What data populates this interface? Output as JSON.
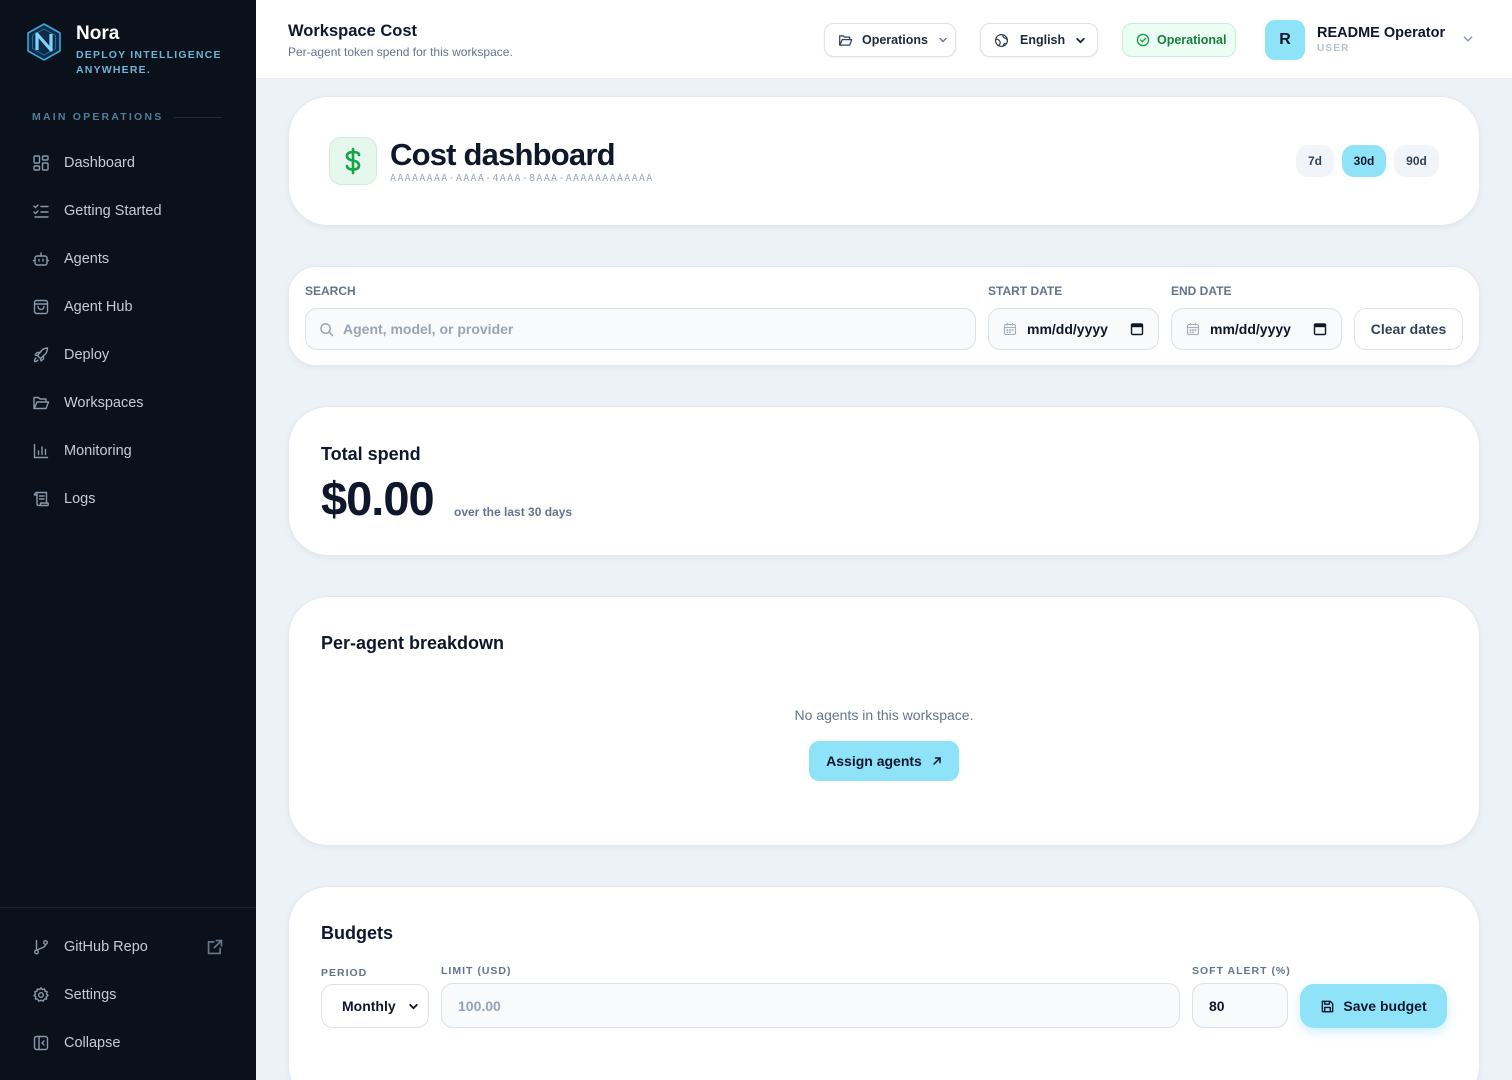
{
  "brand": {
    "name": "Nora",
    "tagline": "DEPLOY INTELLIGENCE ANYWHERE.",
    "logo_letter": "N"
  },
  "sidebar": {
    "section_label": "MAIN OPERATIONS",
    "items": [
      {
        "label": "Dashboard",
        "icon": "dashboard-icon"
      },
      {
        "label": "Getting Started",
        "icon": "checklist-icon"
      },
      {
        "label": "Agents",
        "icon": "bot-icon"
      },
      {
        "label": "Agent Hub",
        "icon": "shopping-bag-icon"
      },
      {
        "label": "Deploy",
        "icon": "rocket-icon"
      },
      {
        "label": "Workspaces",
        "icon": "folder-icon"
      },
      {
        "label": "Monitoring",
        "icon": "bar-chart-icon"
      },
      {
        "label": "Logs",
        "icon": "scroll-icon"
      }
    ],
    "bottom": [
      {
        "label": "GitHub Repo",
        "icon": "git-branch-icon",
        "external": true
      },
      {
        "label": "Settings",
        "icon": "gear-icon"
      },
      {
        "label": "Collapse",
        "icon": "collapse-icon"
      }
    ]
  },
  "header": {
    "title": "Workspace Cost",
    "subtitle": "Per-agent token spend for this workspace.",
    "workspace": "Operations",
    "language": "English",
    "status": "Operational",
    "user": {
      "initial": "R",
      "name": "README Operator",
      "role": "USER"
    }
  },
  "cost": {
    "title": "Cost dashboard",
    "workspace_id": "AAAAAAAA-AAAA-4AAA-8AAA-AAAAAAAAAAAA",
    "ranges": [
      "7d",
      "30d",
      "90d"
    ],
    "active_range": "30d"
  },
  "filters": {
    "search_label": "SEARCH",
    "search_placeholder": "Agent, model, or provider",
    "start_label": "START DATE",
    "start_value": "mm/dd/yyyy",
    "end_label": "END DATE",
    "end_value": "mm/dd/yyyy",
    "clear_label": "Clear dates"
  },
  "total": {
    "label": "Total spend",
    "value": "$0.00",
    "note": "over the last 30 days"
  },
  "agents": {
    "title": "Per-agent breakdown",
    "empty_text": "No agents in this workspace.",
    "assign_label": "Assign agents"
  },
  "budget": {
    "title": "Budgets",
    "period_label": "PERIOD",
    "period_value": "Monthly",
    "limit_label": "LIMIT (USD)",
    "limit_placeholder": "100.00",
    "alert_label": "SOFT ALERT (%)",
    "alert_value": "80",
    "save_label": "Save budget"
  },
  "colors": {
    "accent": "#8ee3f8",
    "sidebar_bg": "#0a111b",
    "status_green": "#15803d",
    "cost_icon_green": "#16a34a"
  }
}
